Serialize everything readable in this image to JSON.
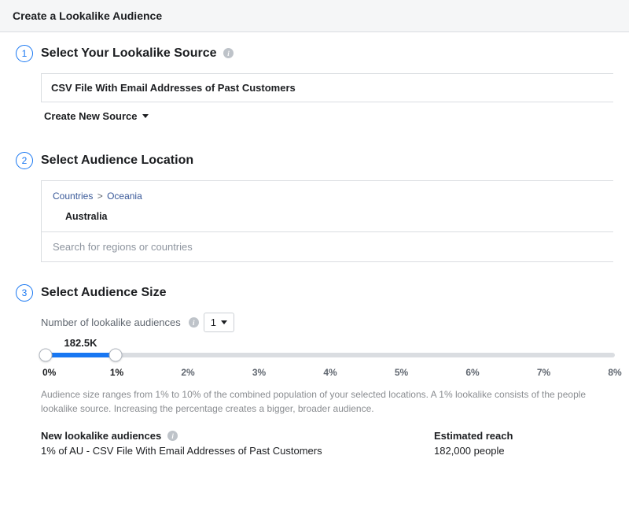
{
  "header": {
    "title": "Create a Lookalike Audience"
  },
  "step1": {
    "number": "1",
    "title": "Select Your Lookalike Source",
    "source_value": "CSV File With Email Addresses of Past Customers",
    "create_new_label": "Create New Source"
  },
  "step2": {
    "number": "2",
    "title": "Select Audience Location",
    "breadcrumb": {
      "root": "Countries",
      "region": "Oceania"
    },
    "selected_country": "Australia",
    "search_placeholder": "Search for regions or countries"
  },
  "step3": {
    "number": "3",
    "title": "Select Audience Size",
    "num_audiences_label": "Number of lookalike audiences",
    "num_audiences_value": "1",
    "slider": {
      "value_label": "182.5K",
      "start_pct": 0,
      "end_pct": 12.3,
      "ticks": [
        "0%",
        "1%",
        "2%",
        "3%",
        "4%",
        "5%",
        "6%",
        "7%",
        "8%"
      ]
    },
    "caption": "Audience size ranges from 1% to 10% of the combined population of your selected locations. A 1% lookalike consists of the people lookalike source. Increasing the percentage creates a bigger, broader audience.",
    "new_audiences_label": "New lookalike audiences",
    "new_audiences_value": "1% of AU - CSV File With Email Addresses of Past Customers",
    "estimated_reach_label": "Estimated reach",
    "estimated_reach_value": "182,000 people"
  }
}
